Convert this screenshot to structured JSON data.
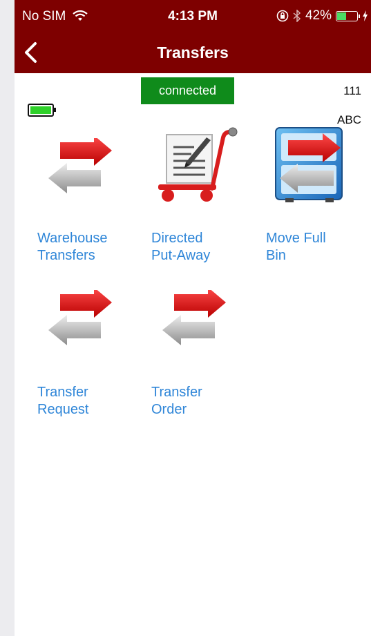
{
  "status_bar": {
    "carrier": "No SIM",
    "time": "4:13 PM",
    "battery_percent": "42%",
    "battery_level": 0.42
  },
  "nav": {
    "title": "Transfers"
  },
  "connection": {
    "status": "connected"
  },
  "device": {
    "id": "111",
    "code": "ABC"
  },
  "tiles": [
    {
      "label": "Warehouse\nTransfers",
      "icon": "transfer-arrows-icon"
    },
    {
      "label": "Directed\nPut-Away",
      "icon": "cart-clipboard-icon"
    },
    {
      "label": "Move Full\nBin",
      "icon": "bin-transfer-icon"
    },
    {
      "label": "Transfer\nRequest",
      "icon": "transfer-arrows-icon"
    },
    {
      "label": "Transfer\nOrder",
      "icon": "transfer-arrows-icon"
    }
  ],
  "colors": {
    "header": "#7e0000",
    "connected": "#0f8b1b",
    "link": "#2f86d8"
  }
}
